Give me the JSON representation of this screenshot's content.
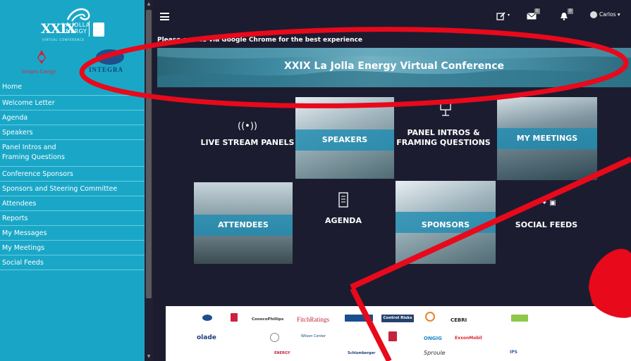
{
  "sidebar": {
    "logo": {
      "roman": "XXIX",
      "line1": "LA JOLLA",
      "line2": "ENERGY",
      "tagline": "VIRTUAL CONFERENCE"
    },
    "sponsors": {
      "sempra": "Sempra Energy",
      "integra": "INTEGRA"
    },
    "items": [
      {
        "label": "Home"
      },
      {
        "label": "Welcome Letter"
      },
      {
        "label": "Agenda"
      },
      {
        "label": "Speakers"
      },
      {
        "label": "Panel Intros and Framing Questions"
      },
      {
        "label": "Conference Sponsors"
      },
      {
        "label": "Sponsors and Steering Committee"
      },
      {
        "label": "Attendees"
      },
      {
        "label": "Reports"
      },
      {
        "label": "My Messages"
      },
      {
        "label": "My Meetings"
      },
      {
        "label": "Social Feeds"
      }
    ]
  },
  "topbar": {
    "messages_count": "0",
    "notifications_count": "0",
    "user_name": "Carlos"
  },
  "notice": "Please access via Google Chrome for the best experience",
  "banner_title": "XXIX La Jolla Energy Virtual Conference",
  "tiles": {
    "live_stream": "LIVE STREAM PANELS",
    "speakers": "SPEAKERS",
    "panel_intros": "PANEL INTROS & FRAMING QUESTIONS",
    "my_meetings": "MY MEETINGS",
    "attendees": "ATTENDEES",
    "agenda": "AGENDA",
    "sponsors": "SPONSORS",
    "social_feeds": "SOCIAL FEEDS"
  },
  "sponsor_logos": {
    "conocophillips": "ConocoPhillips",
    "fitchratings": "FitchRatings",
    "controlrisks": "Control Risks",
    "cebri": "CEBRI",
    "olade": "olade",
    "ongig": "ONGIG",
    "exxonmobil": "ExxonMobil",
    "schlumberger": "Schlumberger",
    "sproule": "Sproule",
    "ips": "IPS",
    "wilson": "Wilson Center",
    "pemex": "ENERGY"
  },
  "colors": {
    "sidebar": "#1aa7c7",
    "background": "#1c1c30",
    "tile_overlay": "#1c8cb2",
    "annotation": "#e8091b"
  }
}
